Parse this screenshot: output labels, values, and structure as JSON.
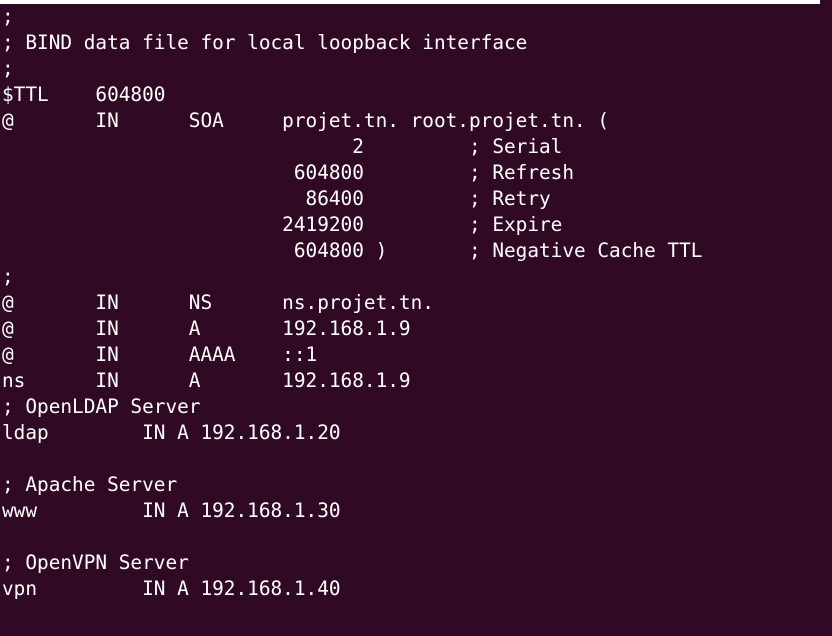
{
  "terminal": {
    "lines": [
      ";",
      "; BIND data file for local loopback interface",
      ";",
      "$TTL    604800",
      "@       IN      SOA     projet.tn. root.projet.tn. (",
      "                              2         ; Serial",
      "                         604800         ; Refresh",
      "                          86400         ; Retry",
      "                        2419200         ; Expire",
      "                         604800 )       ; Negative Cache TTL",
      ";",
      "@       IN      NS      ns.projet.tn.",
      "@       IN      A       192.168.1.9",
      "@       IN      AAAA    ::1",
      "ns      IN      A       192.168.1.9",
      "; OpenLDAP Server",
      "ldap        IN A 192.168.1.20",
      "",
      "; Apache Server",
      "www         IN A 192.168.1.30",
      "",
      "; OpenVPN Server",
      "vpn         IN A 192.168.1.40",
      ""
    ]
  }
}
